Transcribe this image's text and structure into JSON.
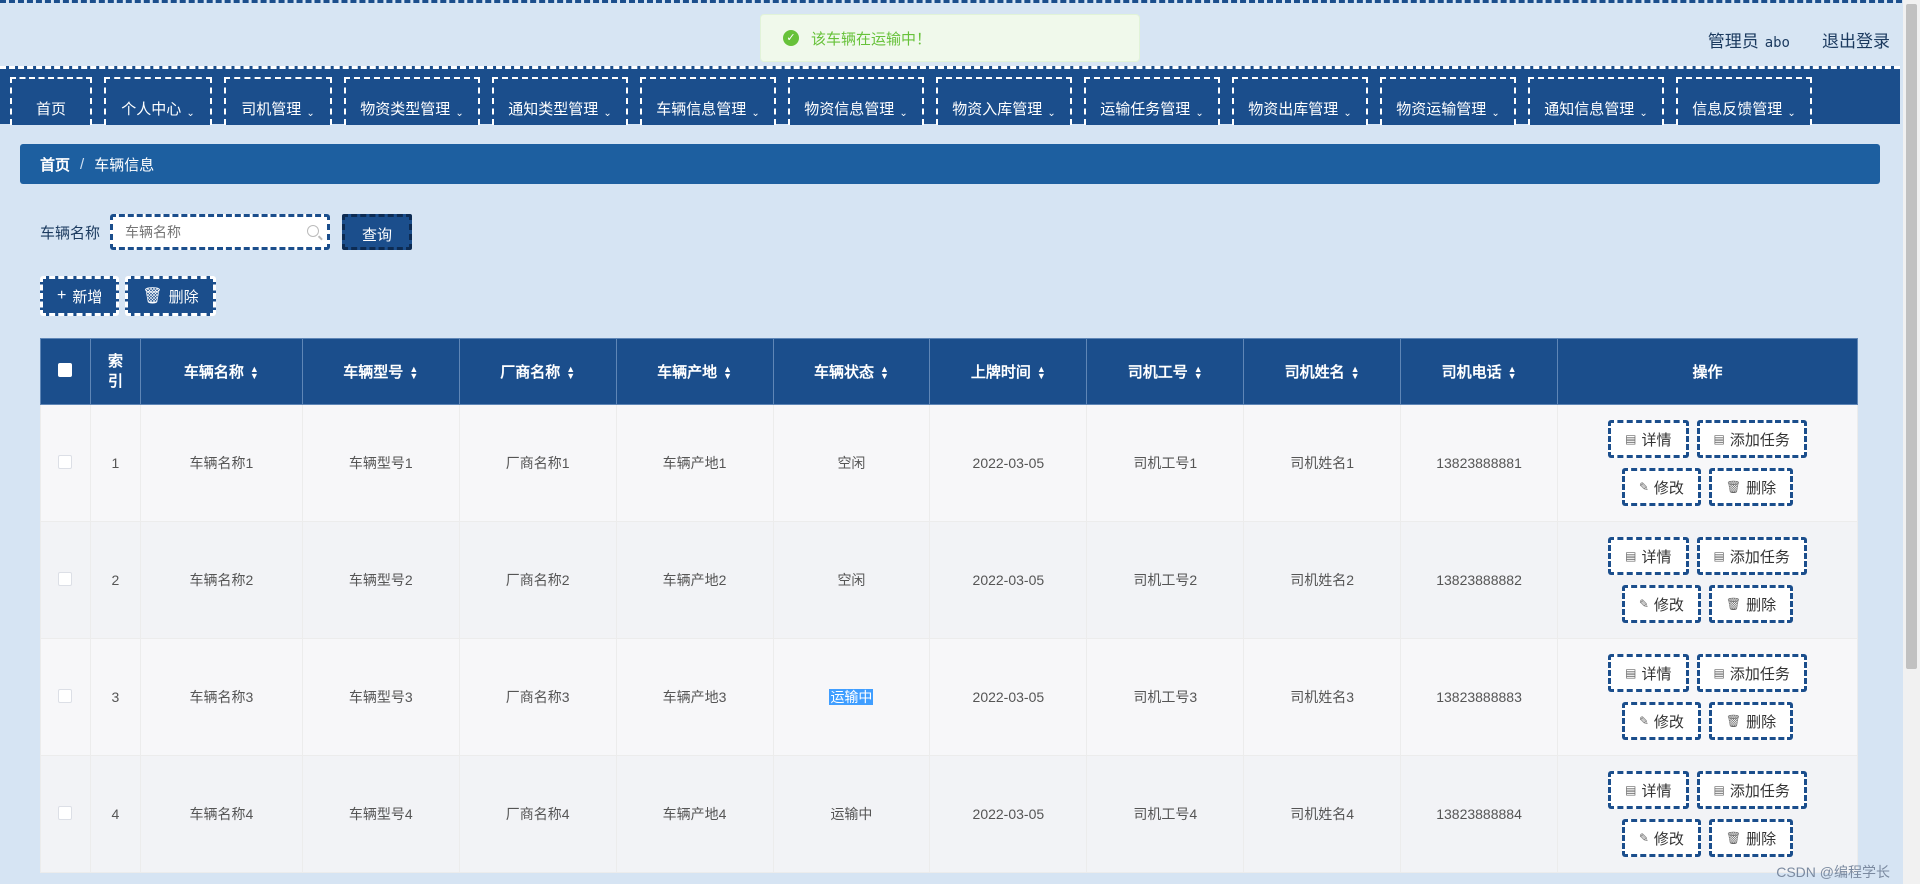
{
  "header": {
    "user_role": "管理员",
    "user_name": "abo",
    "logout": "退出登录"
  },
  "toast": {
    "message": "该车辆在运输中！"
  },
  "nav": [
    {
      "label": "首页",
      "has_dropdown": false
    },
    {
      "label": "个人中心",
      "has_dropdown": true
    },
    {
      "label": "司机管理",
      "has_dropdown": true
    },
    {
      "label": "物资类型管理",
      "has_dropdown": true
    },
    {
      "label": "通知类型管理",
      "has_dropdown": true
    },
    {
      "label": "车辆信息管理",
      "has_dropdown": true
    },
    {
      "label": "物资信息管理",
      "has_dropdown": true
    },
    {
      "label": "物资入库管理",
      "has_dropdown": true
    },
    {
      "label": "运输任务管理",
      "has_dropdown": true
    },
    {
      "label": "物资出库管理",
      "has_dropdown": true
    },
    {
      "label": "物资运输管理",
      "has_dropdown": true
    },
    {
      "label": "通知信息管理",
      "has_dropdown": true
    },
    {
      "label": "信息反馈管理",
      "has_dropdown": true
    }
  ],
  "breadcrumb": {
    "home": "首页",
    "separator": "/",
    "current": "车辆信息"
  },
  "search": {
    "label": "车辆名称",
    "placeholder": "车辆名称",
    "query_button": "查询"
  },
  "actions": {
    "add": "新增",
    "delete": "删除"
  },
  "table": {
    "headers": [
      "索引",
      "车辆名称",
      "车辆型号",
      "厂商名称",
      "车辆产地",
      "车辆状态",
      "上牌时间",
      "司机工号",
      "司机姓名",
      "司机电话",
      "操作"
    ],
    "rows": [
      {
        "index": "1",
        "name": "车辆名称1",
        "model": "车辆型号1",
        "maker": "厂商名称1",
        "origin": "车辆产地1",
        "status": "空闲",
        "date": "2022-03-05",
        "driver_id": "司机工号1",
        "driver_name": "司机姓名1",
        "phone": "13823888881"
      },
      {
        "index": "2",
        "name": "车辆名称2",
        "model": "车辆型号2",
        "maker": "厂商名称2",
        "origin": "车辆产地2",
        "status": "空闲",
        "date": "2022-03-05",
        "driver_id": "司机工号2",
        "driver_name": "司机姓名2",
        "phone": "13823888882"
      },
      {
        "index": "3",
        "name": "车辆名称3",
        "model": "车辆型号3",
        "maker": "厂商名称3",
        "origin": "车辆产地3",
        "status": "运输中",
        "date": "2022-03-05",
        "driver_id": "司机工号3",
        "driver_name": "司机姓名3",
        "phone": "13823888883"
      },
      {
        "index": "4",
        "name": "车辆名称4",
        "model": "车辆型号4",
        "maker": "厂商名称4",
        "origin": "车辆产地4",
        "status": "运输中",
        "date": "2022-03-05",
        "driver_id": "司机工号4",
        "driver_name": "司机姓名4",
        "phone": "13823888884"
      }
    ],
    "row_actions": {
      "detail": "详情",
      "add_task": "添加任务",
      "edit": "修改",
      "delete": "删除"
    }
  },
  "watermark": "CSDN @编程学长",
  "colors": {
    "primary": "#1b4e8c",
    "breadcrumb": "#1d5fa0",
    "background": "#d6e4f3",
    "success": "#67c23a",
    "selection": "#409eff"
  },
  "icons": {
    "check": "check-circle-icon",
    "chevron": "chevron-down-icon",
    "search": "search-icon",
    "plus": "plus-icon",
    "trash": "trash-icon",
    "document": "document-icon",
    "edit": "pencil-icon",
    "sort": "sort-icon"
  }
}
